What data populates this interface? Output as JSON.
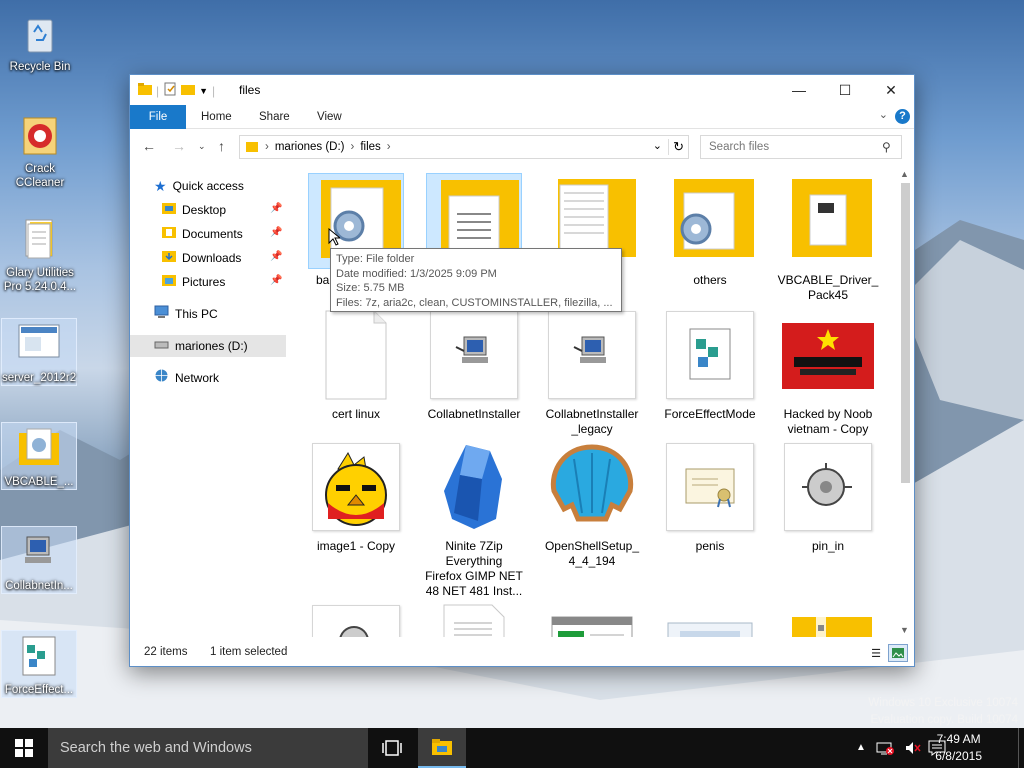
{
  "desktop": {
    "icons": [
      {
        "label": "Recycle Bin"
      },
      {
        "label": "Crack CCleaner"
      },
      {
        "label": "Glary Utilities Pro 5.24.0.4..."
      },
      {
        "label": "server_2012r2"
      },
      {
        "label": "VBCABLE_..."
      },
      {
        "label": "CollabnetIn..."
      },
      {
        "label": "ForceEffect..."
      }
    ]
  },
  "window": {
    "title": "files",
    "caption": {
      "minimize": "—",
      "maximize": "☐",
      "close": "✕"
    },
    "ribbon": {
      "tabs": [
        "File",
        "Home",
        "Share",
        "View"
      ],
      "help": "?"
    },
    "address": {
      "drive": "mariones (D:)",
      "folder": "files"
    },
    "search_placeholder": "Search files",
    "nav": {
      "quick_access": "Quick access",
      "items": [
        "Desktop",
        "Documents",
        "Downloads",
        "Pictures"
      ],
      "this_pc": "This PC",
      "drive": "mariones (D:)",
      "network": "Network"
    },
    "items": [
      {
        "label": "ba..."
      },
      {
        "label": ""
      },
      {
        "label": ""
      },
      {
        "label": "others"
      },
      {
        "label": "VBCABLE_Driver_\nPack45"
      },
      {
        "label": "cert linux"
      },
      {
        "label": "CollabnetInstaller"
      },
      {
        "label": "CollabnetInstaller\n_legacy"
      },
      {
        "label": "ForceEffectMode"
      },
      {
        "label": "Hacked by Noob\nvietnam - Copy"
      },
      {
        "label": "image1 - Copy"
      },
      {
        "label": "Ninite 7Zip\nEverything\nFirefox GIMP NET\n48 NET 481 Inst..."
      },
      {
        "label": "OpenShellSetup_\n4_4_194"
      },
      {
        "label": "penis"
      },
      {
        "label": "pin_in"
      }
    ],
    "tooltip": {
      "type": "Type: File folder",
      "modified": "Date modified: 1/3/2025 9:09 PM",
      "size": "Size: 5.75 MB",
      "files": "Files: 7z, aria2c, clean, CUSTOMINSTALLER, filezilla, ..."
    },
    "status": {
      "count": "22 items",
      "selection": "1 item selected"
    }
  },
  "watermark": {
    "line1": "Windows 10 Exclusive 10074",
    "line2": "Evaluation copy. Build 10074"
  },
  "taskbar": {
    "search_text": "Search the web and Windows",
    "time": "7:49 AM",
    "date": "6/8/2015"
  },
  "colors": {
    "accent": "#1979ca",
    "folder": "#f8c000",
    "taskbar": "#101010"
  }
}
